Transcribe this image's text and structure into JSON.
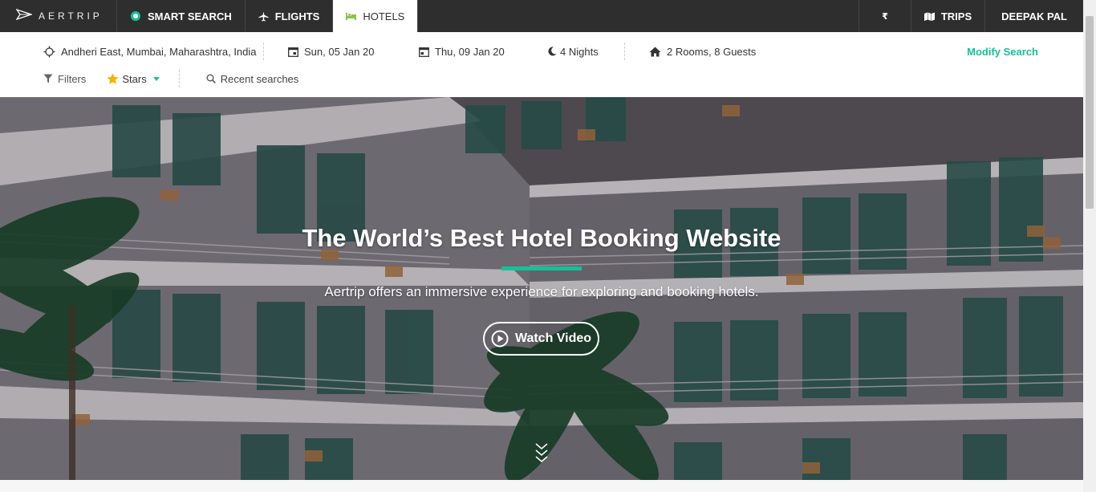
{
  "brand": {
    "logo_text": "AERTRIP"
  },
  "nav": {
    "tabs": [
      {
        "label": "SMART SEARCH",
        "icon": "chat-bubble-icon"
      },
      {
        "label": "FLIGHTS",
        "icon": "plane-icon"
      },
      {
        "label": "HOTELS",
        "icon": "bed-icon",
        "active": true
      }
    ],
    "currency": "₹",
    "trips_label": "TRIPS",
    "user_name": "DEEPAK PAL"
  },
  "search": {
    "location": "Andheri East, Mumbai, Maharashtra, India",
    "checkin": "Sun, 05 Jan 20",
    "checkout": "Thu, 09 Jan 20",
    "nights": "4 Nights",
    "rooms_guests": "2 Rooms, 8 Guests",
    "modify_label": "Modify Search",
    "filters_label": "Filters",
    "stars_label": "Stars",
    "recent_label": "Recent searches"
  },
  "hero": {
    "title": "The World’s Best Hotel Booking Website",
    "subtitle": "Aertrip offers an immersive experience for exploring and booking hotels.",
    "watch_label": "Watch Video"
  },
  "colors": {
    "accent": "#14c29a",
    "nav_bg": "#2e2e2e",
    "star": "#f5b400"
  }
}
